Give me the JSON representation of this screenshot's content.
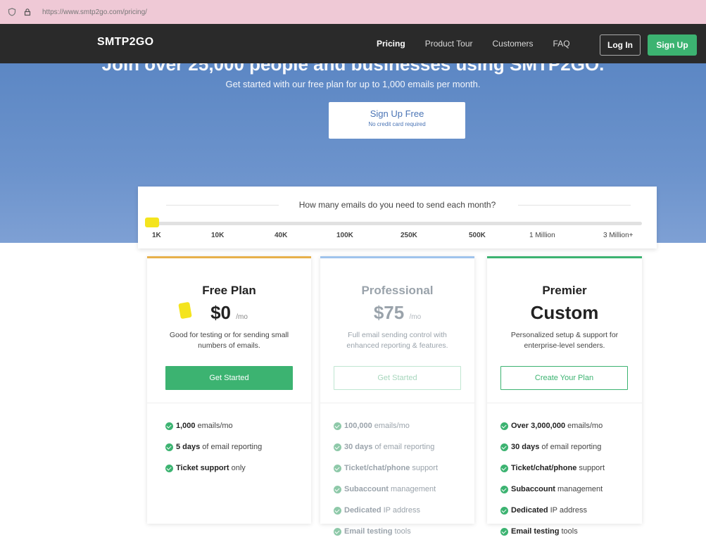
{
  "browser": {
    "url": "https://www.smtp2go.com/pricing/",
    "url_domain": "smtp2go.com"
  },
  "nav": {
    "logo": "SMTP2GO",
    "links": [
      "Pricing",
      "Product Tour",
      "Customers",
      "FAQ"
    ],
    "login": "Log In",
    "signup": "Sign Up"
  },
  "hero": {
    "headline": "Join over 25,000 people and businesses using SMTP2GO.",
    "subtitle": "Get started with our free plan for up to 1,000 emails per month.",
    "cta_title": "Sign Up Free",
    "cta_sub": "No credit card required"
  },
  "slider": {
    "question": "How many emails do you need to send each month?",
    "ticks": [
      "1K",
      "10K",
      "40K",
      "100K",
      "250K",
      "500K",
      "1 Million",
      "3 Million+"
    ],
    "selected": "1K"
  },
  "plans": [
    {
      "name": "Free Plan",
      "price": "$0",
      "per": "/mo",
      "desc": "Good for testing or for sending small numbers of emails.",
      "cta": "Get Started",
      "features": [
        {
          "bold": "1,000",
          "rest": "emails/mo"
        },
        {
          "bold": "5 days",
          "rest": "of email reporting"
        },
        {
          "bold": "Ticket support",
          "rest": "only"
        }
      ]
    },
    {
      "name": "Professional",
      "price": "$75",
      "per": "/mo",
      "desc": "Full email sending control with enhanced reporting & features.",
      "cta": "Get Started",
      "features": [
        {
          "bold": "100,000",
          "rest": "emails/mo"
        },
        {
          "bold": "30 days",
          "rest": "of email reporting"
        },
        {
          "bold": "Ticket/chat/phone",
          "rest": "support"
        },
        {
          "bold": "Subaccount",
          "rest": "management"
        },
        {
          "bold": "Dedicated",
          "rest": "IP address"
        },
        {
          "bold": "Email testing",
          "rest": "tools"
        }
      ]
    },
    {
      "name": "Premier",
      "price": "Custom",
      "per": "",
      "desc": "Personalized setup & support for enterprise-level senders.",
      "cta": "Create Your Plan",
      "features": [
        {
          "bold": "Over 3,000,000",
          "rest": "emails/mo"
        },
        {
          "bold": "30 days",
          "rest": "of email reporting"
        },
        {
          "bold": "Ticket/chat/phone",
          "rest": "support"
        },
        {
          "bold": "Subaccount",
          "rest": "management"
        },
        {
          "bold": "Dedicated",
          "rest": "IP address"
        },
        {
          "bold": "Email testing",
          "rest": "tools"
        }
      ]
    }
  ],
  "colors": {
    "accent": "#3cb371",
    "nav_bg": "#2a2a2a",
    "hero_bg": "#6c93cc",
    "highlight": "#f4e41e"
  }
}
